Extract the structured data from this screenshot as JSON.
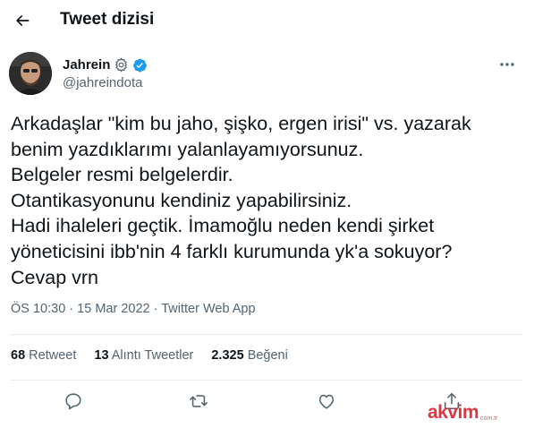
{
  "header": {
    "title": "Tweet dizisi",
    "back_icon": "arrow-left-icon"
  },
  "author": {
    "name": "Jahrein",
    "handle": "@jahreindota",
    "badges": [
      "settings-gear-icon",
      "verified-badge-icon"
    ],
    "verified_color": "#1d9bf0"
  },
  "tweet": {
    "lines": [
      "Arkadaşlar \"kim bu jaho, şişko, ergen irisi\" vs. yazarak",
      "benim yazdıklarımı yalanlayamıyorsunuz.",
      "Belgeler resmi belgelerdir.",
      "Otantikasyonunu kendiniz yapabilirsiniz.",
      "Hadi ihaleleri geçtik. İmamoğlu neden kendi şirket",
      "yöneticisini ibb'nin 4 farklı kurumunda yk'a sokuyor?",
      "Cevap vrn"
    ]
  },
  "meta": {
    "time": "ÖS 10:30",
    "separator": "·",
    "date": "15 Mar 2022",
    "source": "Twitter Web App"
  },
  "stats": {
    "retweets": {
      "count": "68",
      "label": "Retweet"
    },
    "quotes": {
      "count": "13",
      "label": "Alıntı Tweetler"
    },
    "likes": {
      "count": "2.325",
      "label": "Beğeni"
    }
  },
  "actions": [
    "reply-icon",
    "retweet-icon",
    "like-icon",
    "share-icon"
  ],
  "watermark": {
    "brand": "akvim",
    "domain": "com.tr"
  },
  "colors": {
    "text": "#0f1419",
    "secondary": "#536471",
    "divider": "#e6ecf0",
    "watermark": "#d7232d"
  }
}
